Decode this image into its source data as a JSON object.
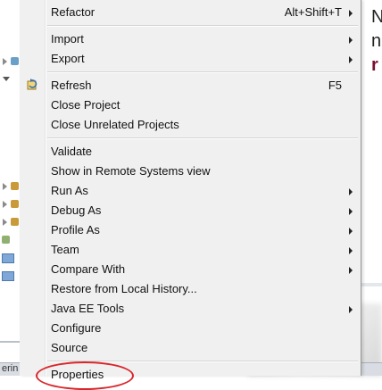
{
  "context_menu": {
    "items": [
      {
        "label": "Refactor",
        "accel": "Alt+Shift+T",
        "submenu": true
      },
      {
        "label": "Import",
        "accel": "",
        "submenu": true
      },
      {
        "label": "Export",
        "accel": "",
        "submenu": true
      },
      {
        "label": "Refresh",
        "accel": "F5",
        "submenu": false,
        "icon": "refresh-icon"
      },
      {
        "label": "Close Project",
        "accel": "",
        "submenu": false
      },
      {
        "label": "Close Unrelated Projects",
        "accel": "",
        "submenu": false
      },
      {
        "label": "Validate",
        "accel": "",
        "submenu": false
      },
      {
        "label": "Show in Remote Systems view",
        "accel": "",
        "submenu": false
      },
      {
        "label": "Run As",
        "accel": "",
        "submenu": true
      },
      {
        "label": "Debug As",
        "accel": "",
        "submenu": true
      },
      {
        "label": "Profile As",
        "accel": "",
        "submenu": true
      },
      {
        "label": "Team",
        "accel": "",
        "submenu": true
      },
      {
        "label": "Compare With",
        "accel": "",
        "submenu": true
      },
      {
        "label": "Restore from Local History...",
        "accel": "",
        "submenu": false
      },
      {
        "label": "Java EE Tools",
        "accel": "",
        "submenu": true
      },
      {
        "label": "Configure",
        "accel": "",
        "submenu": true
      },
      {
        "label": "Source",
        "accel": "",
        "submenu": true
      },
      {
        "label": "Properties",
        "accel": "",
        "submenu": false,
        "highlighted": true
      }
    ]
  },
  "editor": {
    "visible_chars": [
      "N",
      "n",
      "r"
    ]
  },
  "bottom_tab": {
    "label": "erin"
  },
  "colors": {
    "highlight_circle": "#d8262b",
    "menu_bg": "#f0f0f0"
  }
}
